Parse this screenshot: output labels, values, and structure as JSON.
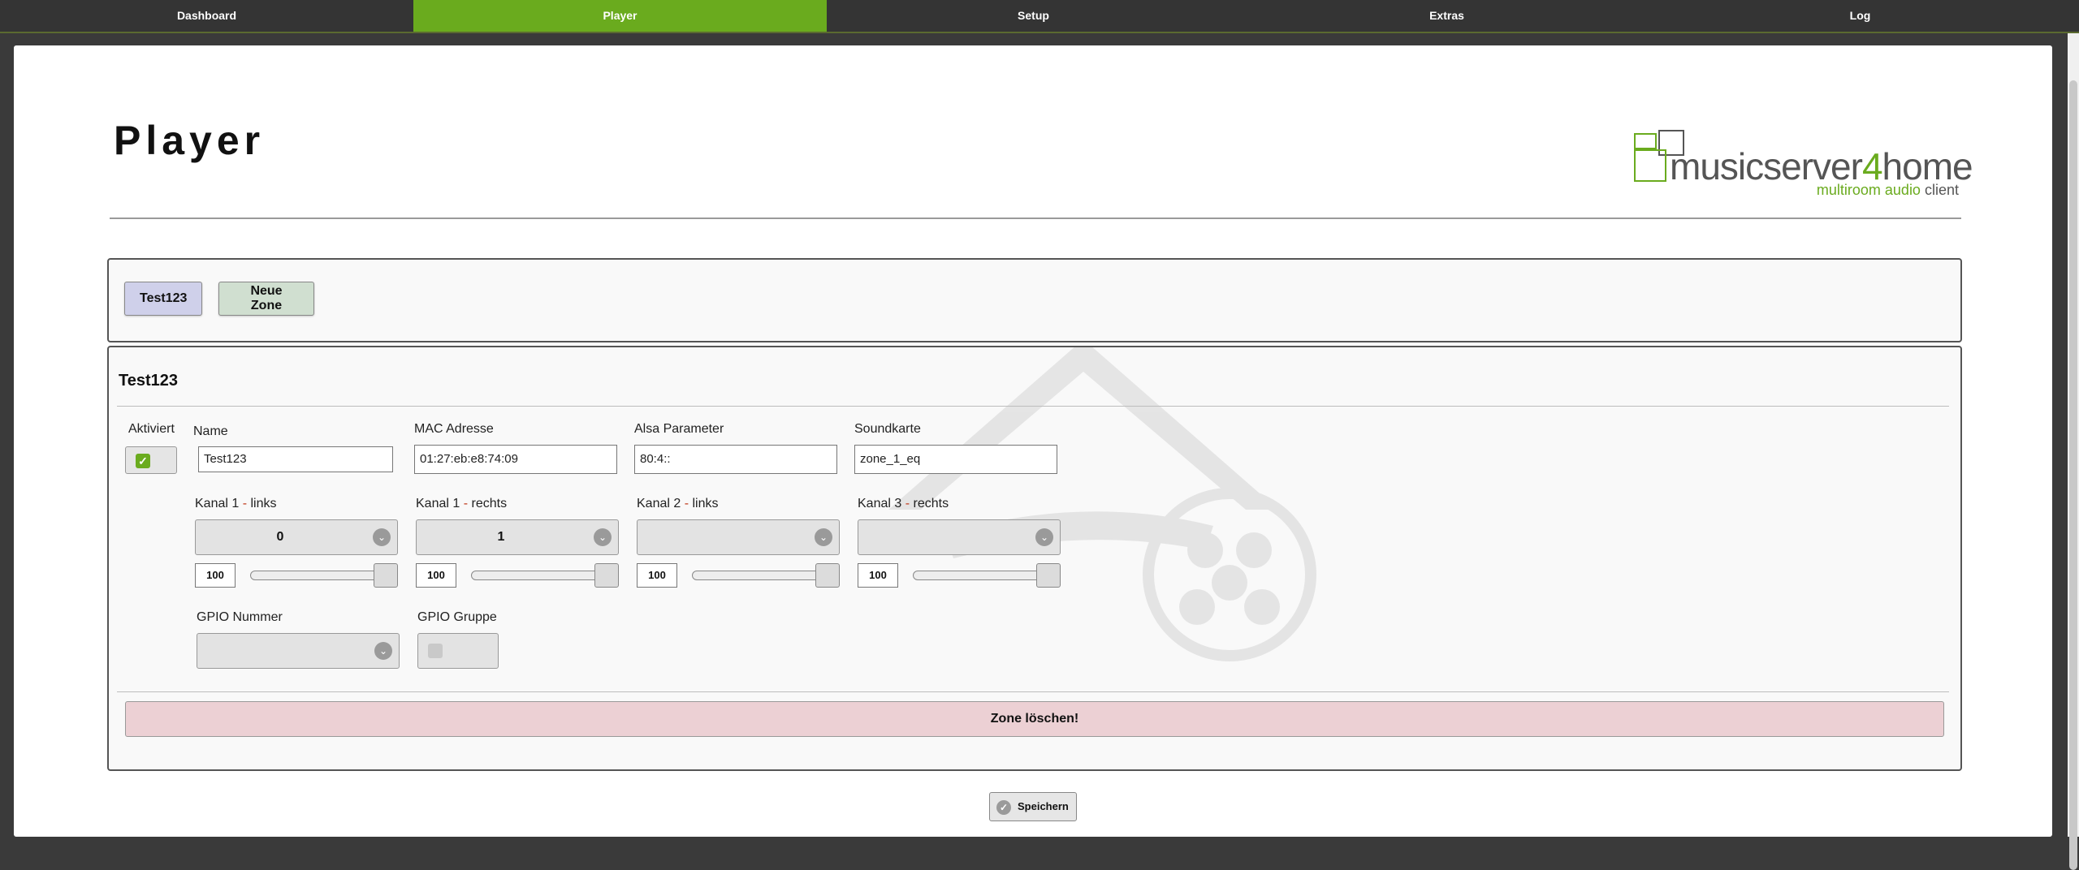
{
  "nav": {
    "items": [
      {
        "label": "Dashboard",
        "active": false
      },
      {
        "label": "Player",
        "active": true
      },
      {
        "label": "Setup",
        "active": false
      },
      {
        "label": "Extras",
        "active": false
      },
      {
        "label": "Log",
        "active": false
      }
    ]
  },
  "page": {
    "title": "Player",
    "logo": {
      "name_part1": "musicserver",
      "name_part2": "4",
      "name_part3": "home",
      "subtitle_part1": "multiroom audio",
      "subtitle_part2": "client"
    }
  },
  "zones": {
    "buttons": [
      "Test123",
      "Neue Zone"
    ]
  },
  "zone": {
    "name": "Test123",
    "aktiviert_label": "Aktiviert",
    "aktiviert_checked": true,
    "fields": {
      "name": {
        "label": "Name",
        "value": "Test123"
      },
      "mac": {
        "label": "MAC Adresse",
        "value": "01:27:eb:e8:74:09"
      },
      "alsa": {
        "label": "Alsa Parameter",
        "value": "80:4::"
      },
      "soundkarte": {
        "label": "Soundkarte",
        "value": "zone_1_eq"
      }
    },
    "channels": [
      {
        "label_pre": "Kanal 1 ",
        "label_dash": "-",
        "label_post": " links",
        "selected": "0",
        "volume": "100",
        "slider_level": 1.0
      },
      {
        "label_pre": "Kanal 1 ",
        "label_dash": "-",
        "label_post": " rechts",
        "selected": "1",
        "volume": "100",
        "slider_level": 1.0
      },
      {
        "label_pre": "Kanal 2 ",
        "label_dash": "-",
        "label_post": " links",
        "selected": "",
        "volume": "100",
        "slider_level": 1.0
      },
      {
        "label_pre": "Kanal 3 ",
        "label_dash": "-",
        "label_post": " rechts",
        "selected": "",
        "volume": "100",
        "slider_level": 1.0
      }
    ],
    "gpio": {
      "nummer_label": "GPIO Nummer",
      "nummer_value": "",
      "gruppe_label": "GPIO Gruppe",
      "gruppe_checked": false
    },
    "delete_label": "Zone löschen!"
  },
  "save_label": "Speichern",
  "colors": {
    "accent": "#6aab1e",
    "nav_bg": "#343434",
    "zone_button_1": "#cfd0ea",
    "zone_button_2": "#d0dfd0",
    "delete_bg": "#ecd0d4"
  },
  "icons": {
    "chevron": "chevron-down-icon",
    "check": "checkmark-icon",
    "save": "check-circle-icon"
  }
}
